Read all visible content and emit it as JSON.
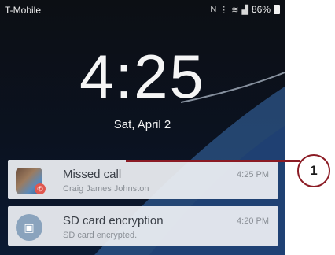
{
  "status_bar": {
    "carrier": "T-Mobile",
    "battery": "86%",
    "icons": [
      "nfc-icon",
      "vibrate-icon",
      "wifi-icon",
      "signal-icon",
      "battery-icon"
    ]
  },
  "lockscreen": {
    "time": "4:25",
    "date": "Sat, April 2"
  },
  "notifications": [
    {
      "title": "Missed call",
      "subtitle": "Craig James Johnston",
      "time": "4:25 PM",
      "icon": "contact-avatar-icon",
      "badge": "missed-call-icon"
    },
    {
      "title": "SD card encryption",
      "subtitle": "SD card encrypted.",
      "time": "4:20 PM",
      "icon": "sd-lock-icon"
    }
  ],
  "callout": {
    "label": "1"
  },
  "colors": {
    "callout": "#8b1b24",
    "notification_bg": "#eef0f4",
    "wallpaper": "#0b1220"
  }
}
